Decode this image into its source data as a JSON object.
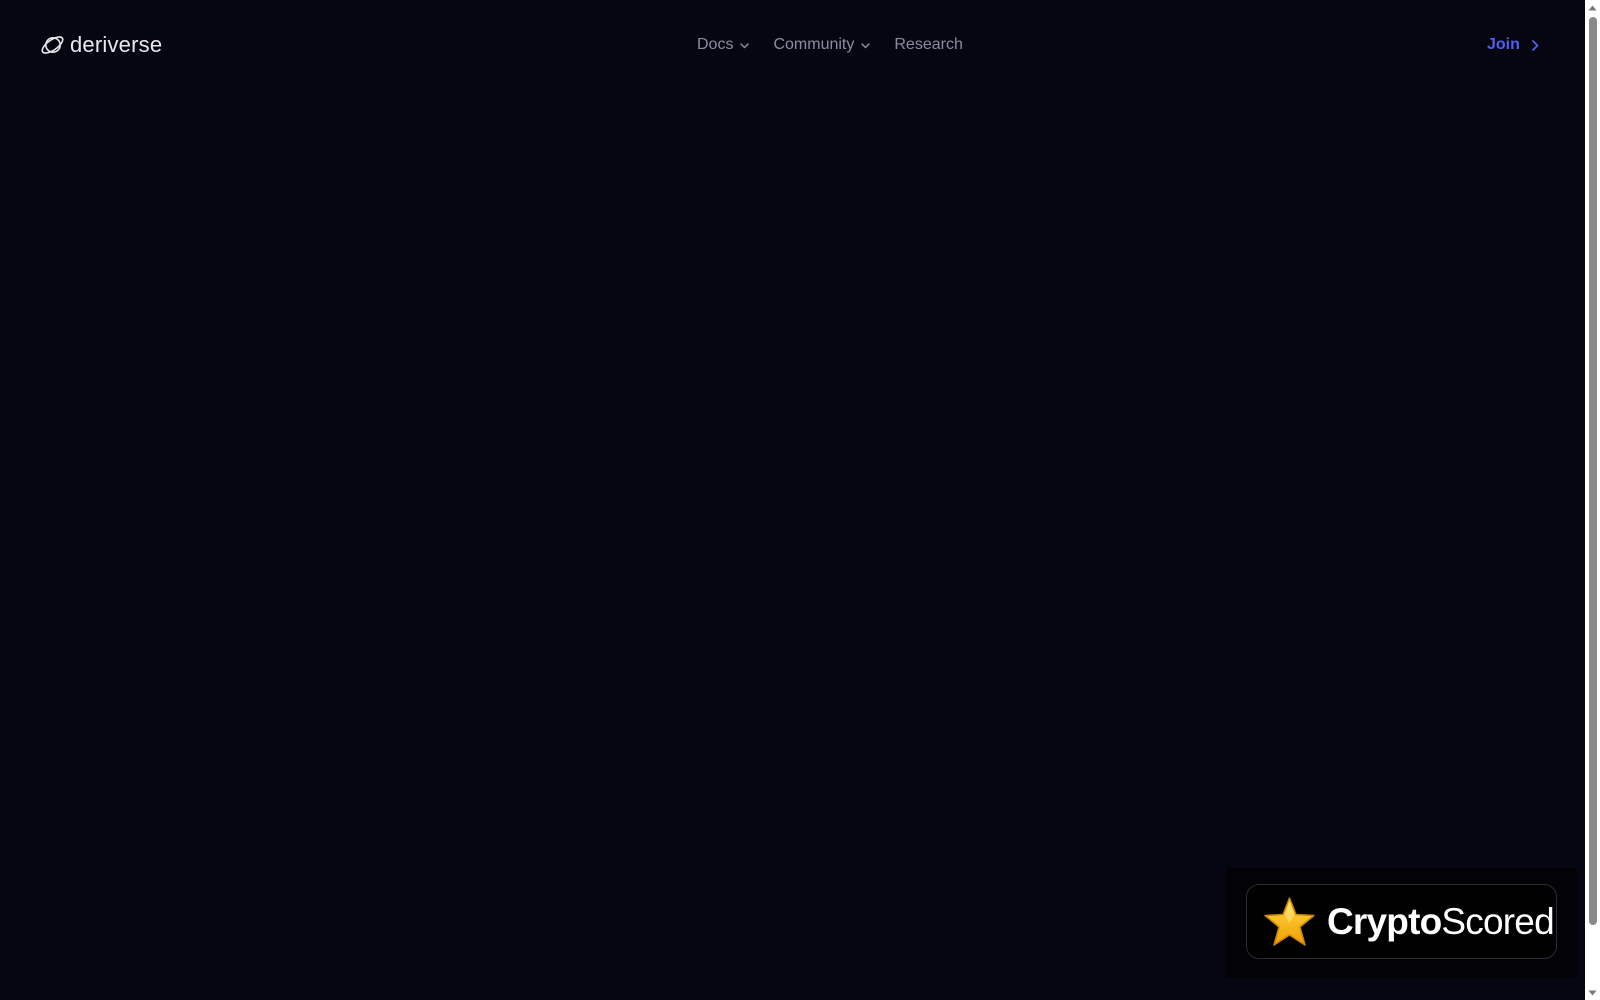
{
  "brand": {
    "name": "deriverse",
    "logo_icon": "orbit-ring-icon"
  },
  "nav": {
    "items": [
      {
        "label": "Docs",
        "has_dropdown": true
      },
      {
        "label": "Community",
        "has_dropdown": true
      },
      {
        "label": "Research",
        "has_dropdown": false
      }
    ]
  },
  "join": {
    "label": "Join",
    "icon": "chevron-right-icon"
  },
  "badge": {
    "text_bold": "Crypto",
    "text_regular": "Scored",
    "icon": "star-icon"
  },
  "colors": {
    "background": "#060612",
    "nav_text": "#8c8c9e",
    "accent": "#4f5ef0",
    "logo_text": "#e8e8ee",
    "star": "#f5b400"
  }
}
